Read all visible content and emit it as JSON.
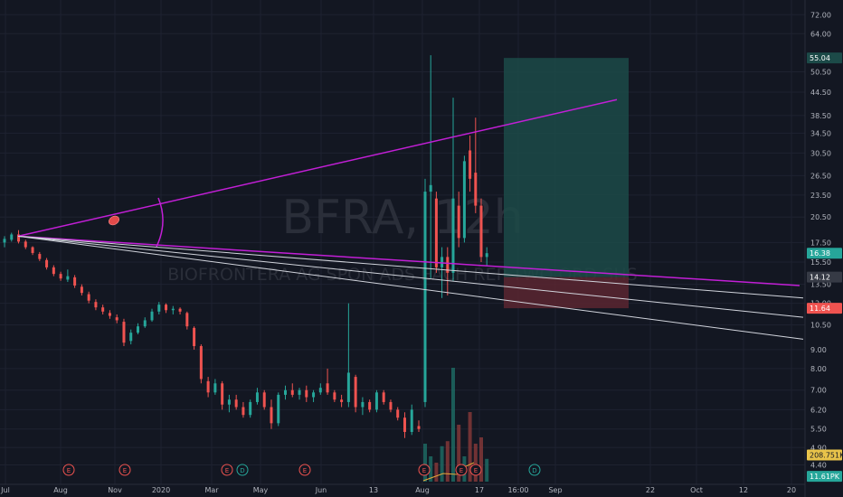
{
  "watermark": {
    "symbol": "BFRA, 12h",
    "description": "BIOFRONTERA AG SPON ADS EACH REP TWO ORD SHS"
  },
  "colors": {
    "background": "#131722",
    "grid": "#1e2230",
    "up": "#26a69a",
    "down": "#ef5350",
    "trendline": "#c21fd6",
    "fan": "#d1d4dc",
    "target_zone": "#1c4a48",
    "stop_zone": "#5a2630"
  },
  "chart_data": {
    "type": "candlestick",
    "title": "",
    "y_scale": "log",
    "ylim": [
      3.9,
      78
    ],
    "y_ticks": [
      "72.00",
      "64.00",
      "50.50",
      "44.50",
      "38.50",
      "34.50",
      "30.50",
      "26.50",
      "23.50",
      "20.50",
      "17.50",
      "15.50",
      "13.50",
      "12.00",
      "10.50",
      "9.00",
      "8.00",
      "7.00",
      "6.20",
      "5.50",
      "4.90",
      "4.40"
    ],
    "x_ticks": [
      "Jul",
      "Aug",
      "Nov",
      "2020",
      "Mar",
      "May",
      "Jun",
      "13",
      "Aug",
      "17",
      "16:00",
      "Sep",
      "22",
      "Oct",
      "12",
      "20"
    ],
    "price_badges": [
      {
        "label": "55.04",
        "value": 55.04,
        "color": "#1c4a48"
      },
      {
        "label": "16.38",
        "value": 16.38,
        "color": "#26a69a"
      },
      {
        "label": "14.12",
        "value": 14.12,
        "color": "#363a45"
      },
      {
        "label": "11.64",
        "value": 11.64,
        "color": "#ef5350"
      },
      {
        "label": "208.751K",
        "value": 4.68,
        "color": "#e8c34a"
      },
      {
        "label": "11.61PK",
        "value": 4.1,
        "color": "#26a69a"
      }
    ],
    "candles": [
      {
        "o": 17.5,
        "h": 18.2,
        "l": 17.0,
        "c": 17.9
      },
      {
        "o": 17.8,
        "h": 18.6,
        "l": 17.6,
        "c": 18.4
      },
      {
        "o": 18.4,
        "h": 18.9,
        "l": 17.4,
        "c": 17.6
      },
      {
        "o": 17.6,
        "h": 17.8,
        "l": 16.8,
        "c": 17.0
      },
      {
        "o": 17.0,
        "h": 17.1,
        "l": 16.2,
        "c": 16.4
      },
      {
        "o": 16.3,
        "h": 16.5,
        "l": 15.6,
        "c": 15.8
      },
      {
        "o": 15.7,
        "h": 15.9,
        "l": 14.8,
        "c": 15.0
      },
      {
        "o": 15.0,
        "h": 15.2,
        "l": 14.2,
        "c": 14.4
      },
      {
        "o": 14.4,
        "h": 14.6,
        "l": 13.8,
        "c": 14.0
      },
      {
        "o": 13.9,
        "h": 14.8,
        "l": 13.7,
        "c": 14.2
      },
      {
        "o": 14.1,
        "h": 14.3,
        "l": 13.2,
        "c": 13.4
      },
      {
        "o": 13.3,
        "h": 13.5,
        "l": 12.6,
        "c": 12.8
      },
      {
        "o": 12.7,
        "h": 12.9,
        "l": 12.0,
        "c": 12.2
      },
      {
        "o": 12.1,
        "h": 12.3,
        "l": 11.5,
        "c": 11.7
      },
      {
        "o": 11.7,
        "h": 11.9,
        "l": 11.2,
        "c": 11.4
      },
      {
        "o": 11.3,
        "h": 11.5,
        "l": 10.9,
        "c": 11.1
      },
      {
        "o": 11.0,
        "h": 11.2,
        "l": 10.6,
        "c": 10.8
      },
      {
        "o": 10.7,
        "h": 10.9,
        "l": 9.2,
        "c": 9.4
      },
      {
        "o": 9.5,
        "h": 10.2,
        "l": 9.3,
        "c": 10.0
      },
      {
        "o": 10.0,
        "h": 10.6,
        "l": 9.9,
        "c": 10.4
      },
      {
        "o": 10.4,
        "h": 11.0,
        "l": 10.3,
        "c": 10.8
      },
      {
        "o": 10.8,
        "h": 11.6,
        "l": 10.7,
        "c": 11.4
      },
      {
        "o": 11.4,
        "h": 12.1,
        "l": 11.2,
        "c": 11.9
      },
      {
        "o": 11.9,
        "h": 12.0,
        "l": 11.3,
        "c": 11.5
      },
      {
        "o": 11.5,
        "h": 11.8,
        "l": 11.2,
        "c": 11.6
      },
      {
        "o": 11.6,
        "h": 11.7,
        "l": 11.2,
        "c": 11.4
      },
      {
        "o": 11.3,
        "h": 11.4,
        "l": 10.2,
        "c": 10.4
      },
      {
        "o": 10.3,
        "h": 10.4,
        "l": 9.0,
        "c": 9.2
      },
      {
        "o": 9.2,
        "h": 9.3,
        "l": 7.3,
        "c": 7.5
      },
      {
        "o": 7.4,
        "h": 7.6,
        "l": 6.7,
        "c": 6.9
      },
      {
        "o": 6.9,
        "h": 7.5,
        "l": 6.8,
        "c": 7.3
      },
      {
        "o": 7.3,
        "h": 7.4,
        "l": 6.2,
        "c": 6.4
      },
      {
        "o": 6.4,
        "h": 6.8,
        "l": 6.1,
        "c": 6.6
      },
      {
        "o": 6.6,
        "h": 6.8,
        "l": 6.2,
        "c": 6.3
      },
      {
        "o": 6.3,
        "h": 6.5,
        "l": 5.9,
        "c": 6.0
      },
      {
        "o": 6.0,
        "h": 6.6,
        "l": 5.9,
        "c": 6.5
      },
      {
        "o": 6.5,
        "h": 7.1,
        "l": 6.4,
        "c": 6.9
      },
      {
        "o": 6.9,
        "h": 7.0,
        "l": 6.2,
        "c": 6.3
      },
      {
        "o": 6.3,
        "h": 6.6,
        "l": 5.5,
        "c": 5.7
      },
      {
        "o": 5.7,
        "h": 6.9,
        "l": 5.6,
        "c": 6.8
      },
      {
        "o": 6.8,
        "h": 7.2,
        "l": 6.6,
        "c": 7.0
      },
      {
        "o": 7.0,
        "h": 7.3,
        "l": 6.7,
        "c": 6.8
      },
      {
        "o": 6.8,
        "h": 7.1,
        "l": 6.6,
        "c": 7.0
      },
      {
        "o": 7.0,
        "h": 7.2,
        "l": 6.5,
        "c": 6.7
      },
      {
        "o": 6.7,
        "h": 7.0,
        "l": 6.5,
        "c": 6.9
      },
      {
        "o": 6.9,
        "h": 7.3,
        "l": 6.8,
        "c": 7.1
      },
      {
        "o": 7.3,
        "h": 8.0,
        "l": 6.8,
        "c": 6.9
      },
      {
        "o": 6.9,
        "h": 7.0,
        "l": 6.5,
        "c": 6.6
      },
      {
        "o": 6.6,
        "h": 6.8,
        "l": 6.3,
        "c": 6.5
      },
      {
        "o": 6.5,
        "h": 12.0,
        "l": 6.3,
        "c": 7.8
      },
      {
        "o": 7.6,
        "h": 7.7,
        "l": 6.1,
        "c": 6.3
      },
      {
        "o": 6.3,
        "h": 6.7,
        "l": 6.0,
        "c": 6.5
      },
      {
        "o": 6.5,
        "h": 6.6,
        "l": 6.1,
        "c": 6.2
      },
      {
        "o": 6.2,
        "h": 7.0,
        "l": 6.1,
        "c": 6.9
      },
      {
        "o": 6.9,
        "h": 7.0,
        "l": 6.4,
        "c": 6.5
      },
      {
        "o": 6.5,
        "h": 6.6,
        "l": 6.1,
        "c": 6.2
      },
      {
        "o": 6.2,
        "h": 6.3,
        "l": 5.8,
        "c": 5.9
      },
      {
        "o": 5.9,
        "h": 6.1,
        "l": 5.2,
        "c": 5.4
      },
      {
        "o": 5.4,
        "h": 6.4,
        "l": 5.3,
        "c": 6.2
      },
      {
        "o": 5.6,
        "h": 5.8,
        "l": 5.4,
        "c": 5.5
      },
      {
        "o": 6.5,
        "h": 26.0,
        "l": 6.3,
        "c": 24.0
      },
      {
        "o": 24.0,
        "h": 56.0,
        "l": 14.0,
        "c": 25.0
      },
      {
        "o": 23.0,
        "h": 24.0,
        "l": 14.5,
        "c": 15.0
      },
      {
        "o": 15.0,
        "h": 17.0,
        "l": 12.4,
        "c": 16.0
      },
      {
        "o": 16.0,
        "h": 17.0,
        "l": 12.6,
        "c": 14.5
      },
      {
        "o": 14.5,
        "h": 43.0,
        "l": 13.8,
        "c": 23.0
      },
      {
        "o": 22.0,
        "h": 24.0,
        "l": 17.0,
        "c": 18.0
      },
      {
        "o": 18.0,
        "h": 30.0,
        "l": 17.5,
        "c": 29.0
      },
      {
        "o": 31.0,
        "h": 34.0,
        "l": 24.0,
        "c": 26.0
      },
      {
        "o": 27.0,
        "h": 38.0,
        "l": 21.0,
        "c": 22.0
      },
      {
        "o": 22.0,
        "h": 23.0,
        "l": 15.5,
        "c": 16.0
      },
      {
        "o": 16.0,
        "h": 17.0,
        "l": 15.2,
        "c": 16.38
      }
    ],
    "volume_spikes": [
      {
        "x": 60,
        "height": 0.3
      },
      {
        "x": 61,
        "height": 0.2
      },
      {
        "x": 62,
        "height": 0.15
      },
      {
        "x": 63,
        "height": 0.28
      },
      {
        "x": 64,
        "height": 0.32
      },
      {
        "x": 65,
        "height": 0.9
      },
      {
        "x": 66,
        "height": 0.45
      },
      {
        "x": 67,
        "height": 0.2
      },
      {
        "x": 68,
        "height": 0.55
      },
      {
        "x": 69,
        "height": 0.3
      },
      {
        "x": 70,
        "height": 0.35
      },
      {
        "x": 71,
        "height": 0.18
      }
    ],
    "event_markers": [
      {
        "label": "E",
        "type": "earnings"
      },
      {
        "label": "E",
        "type": "earnings"
      },
      {
        "label": "E",
        "type": "earnings"
      },
      {
        "label": "D",
        "type": "dividend"
      },
      {
        "label": "E",
        "type": "earnings"
      },
      {
        "label": "E",
        "type": "earnings"
      },
      {
        "label": "E",
        "type": "earnings"
      },
      {
        "label": "E",
        "type": "earnings"
      },
      {
        "label": "D",
        "type": "dividend"
      },
      {
        "label": "E",
        "type": "earnings"
      }
    ],
    "drawings": {
      "upper_trendline": {
        "from": 18.2,
        "to": 42.5
      },
      "lower_trendline": {
        "from": 18.2,
        "to": 13.4
      },
      "fan_lines": [
        {
          "from": 18.2,
          "to": 12.4
        },
        {
          "from": 18.2,
          "to": 11.0
        },
        {
          "from": 18.2,
          "to": 9.6
        }
      ],
      "target_zone": {
        "top": 55.04,
        "bottom": 14.12
      },
      "stop_zone": {
        "top": 14.12,
        "bottom": 11.64
      }
    }
  }
}
